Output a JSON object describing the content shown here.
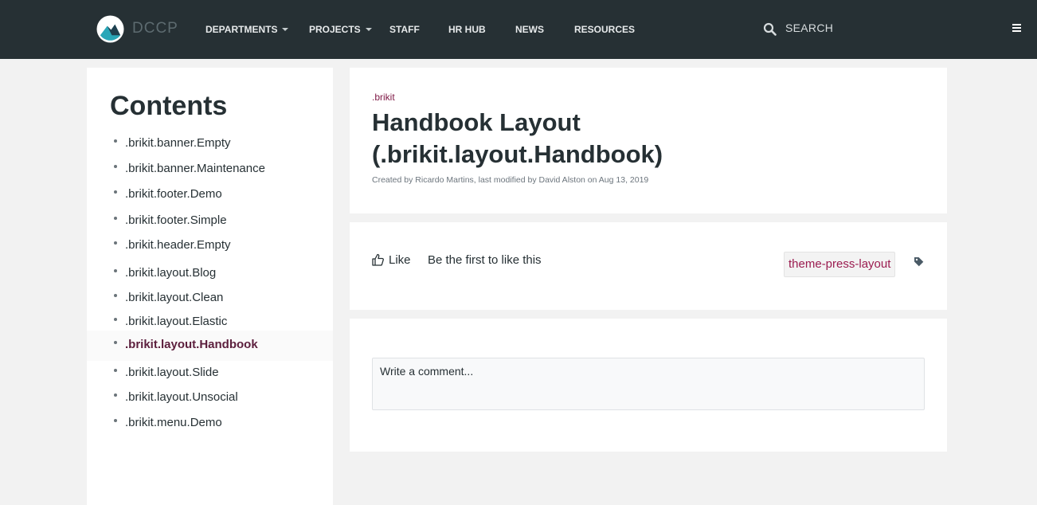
{
  "header": {
    "brand": "DCCP",
    "nav": [
      {
        "label": "DEPARTMENTS",
        "has_dropdown": true
      },
      {
        "label": "PROJECTS",
        "has_dropdown": true
      },
      {
        "label": "STAFF",
        "has_dropdown": false
      },
      {
        "label": "HR HUB",
        "has_dropdown": false
      },
      {
        "label": "NEWS",
        "has_dropdown": false
      },
      {
        "label": "RESOURCES",
        "has_dropdown": false
      }
    ],
    "search_label": "SEARCH",
    "icons": [
      "search-icon",
      "hamburger-menu-icon",
      "logo-icon"
    ],
    "colors": {
      "bar": "#263034",
      "accent": "#7e1845"
    }
  },
  "sidebar": {
    "heading": "Contents",
    "items": [
      {
        "label": ".brikit.banner.Empty"
      },
      {
        "label": ".brikit.banner.Maintenance"
      },
      {
        "label": ".brikit.footer.Demo"
      },
      {
        "label": ".brikit.footer.Simple"
      },
      {
        "label": ".brikit.header.Empty"
      },
      {
        "label": ".brikit.layout.Blog"
      },
      {
        "label": ".brikit.layout.Clean"
      },
      {
        "label": ".brikit.layout.Elastic"
      },
      {
        "label": ".brikit.layout.Handbook",
        "active": true
      },
      {
        "label": ".brikit.layout.Slide"
      },
      {
        "label": ".brikit.layout.Unsocial"
      },
      {
        "label": ".brikit.menu.Demo"
      }
    ]
  },
  "page": {
    "breadcrumb": ".brikit",
    "title_line1": "Handbook Layout",
    "title_line2": "(.brikit.layout.Handbook)",
    "byline": "Created by Ricardo Martins, last modified by David Alston on Aug 13, 2019"
  },
  "likes": {
    "like_label": "Like",
    "like_note": "Be the first to like this",
    "label_chip": "theme-press-layout"
  },
  "comments": {
    "placeholder": "Write a comment..."
  }
}
